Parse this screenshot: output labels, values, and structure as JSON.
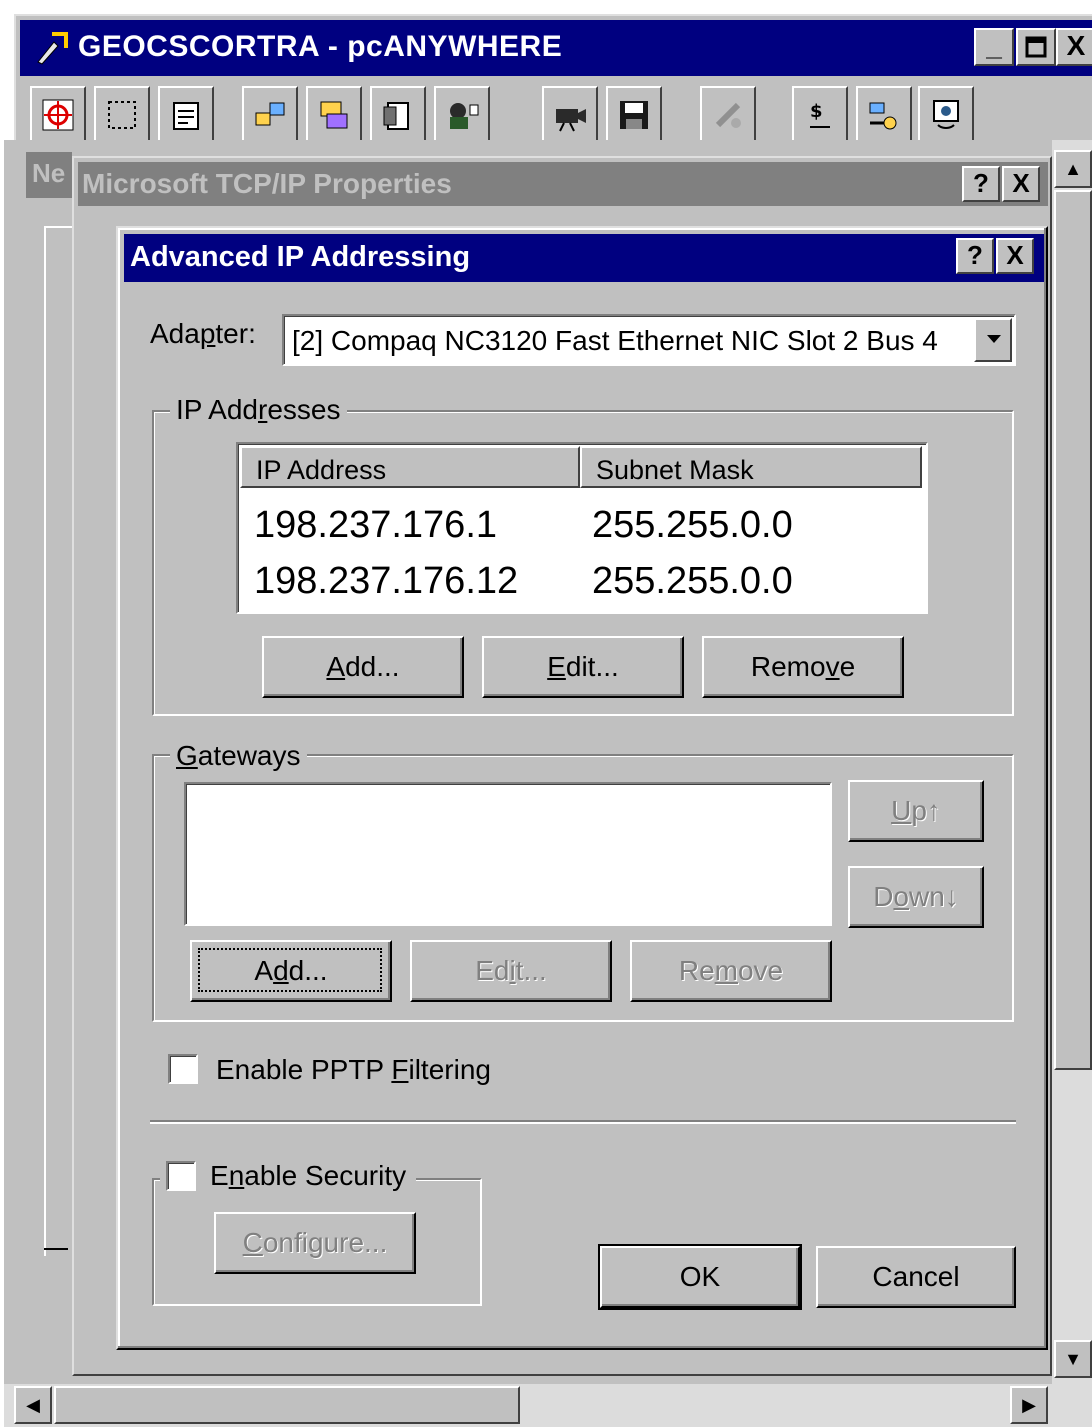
{
  "app_window": {
    "title": "GEOCSCORTRA - pcANYWHERE",
    "minimize": "_",
    "maximize": "□",
    "close": "X"
  },
  "toolbar_icons": [
    "remote-control-icon",
    "select-icon",
    "properties-icon",
    "transfer-icon",
    "sync-icon",
    "clipboard-icon",
    "chat-icon",
    "record-icon",
    "save-icon",
    "disconnect-icon",
    "filename-icon",
    "security-key-icon",
    "help-icon"
  ],
  "background_window": {
    "tab_label": "Ne"
  },
  "tcpip_window": {
    "title": "Microsoft TCP/IP Properties",
    "help": "?",
    "close": "X"
  },
  "dialog": {
    "title": "Advanced IP Addressing",
    "help": "?",
    "close": "X",
    "adapter_label_pre": "Ada",
    "adapter_label_u": "p",
    "adapter_label_post": "ter:",
    "adapter_value": "[2] Compaq NC3120 Fast Ethernet NIC  Slot 2 Bus 4",
    "ip_group": {
      "label_pre": "IP Add",
      "label_u": "r",
      "label_post": "esses",
      "columns": [
        "IP Address",
        "Subnet Mask"
      ],
      "rows": [
        {
          "ip": "198.237.176.1",
          "mask": "255.255.0.0"
        },
        {
          "ip": "198.237.176.12",
          "mask": "255.255.0.0"
        }
      ],
      "add_u": "A",
      "add_post": "dd...",
      "edit_u": "E",
      "edit_post": "dit...",
      "remove_pre": "Remo",
      "remove_u": "v",
      "remove_post": "e"
    },
    "gateways_group": {
      "label_u": "G",
      "label_post": "ateways",
      "up_u": "U",
      "up_post": "p↑",
      "down_pre": "D",
      "down_u": "o",
      "down_post": "wn↓",
      "add_pre": "A",
      "add_u": "d",
      "add_post": "d...",
      "edit_pre": "Ed",
      "edit_u": "i",
      "edit_post": "t...",
      "remove_pre": "Re",
      "remove_u": "m",
      "remove_post": "ove"
    },
    "pptp": {
      "label_pre": "Enable PPTP ",
      "label_u": "F",
      "label_post": "iltering",
      "checked": false
    },
    "security": {
      "label_pre": "E",
      "label_u": "n",
      "label_post": "able Security",
      "checked": false,
      "configure_pre": "",
      "configure_u": "C",
      "configure_post": "onfigure..."
    },
    "ok_label": "OK",
    "cancel_label": "Cancel"
  }
}
